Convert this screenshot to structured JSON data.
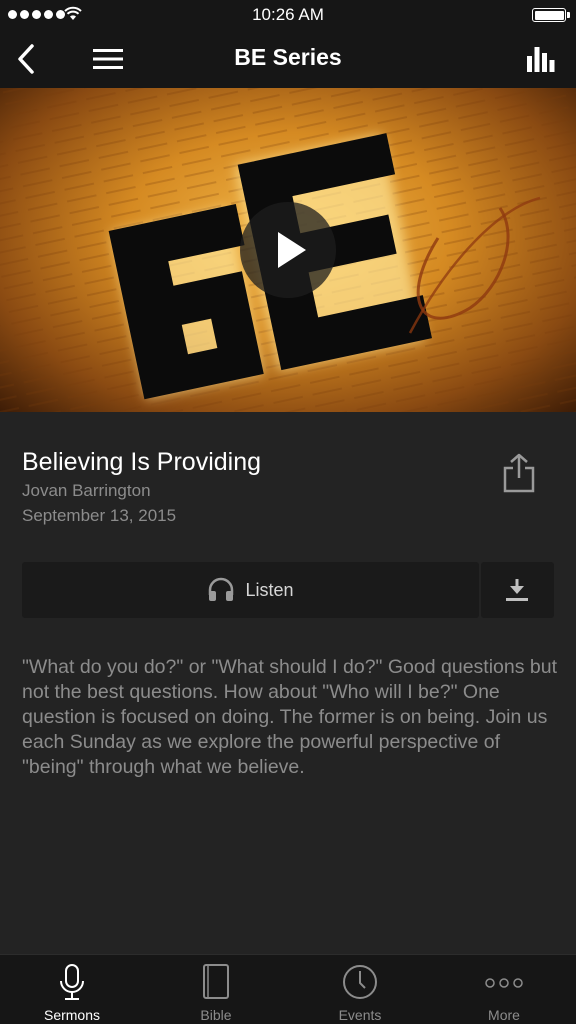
{
  "status_bar": {
    "time": "10:26 AM",
    "signal_icon": "signal-dots-icon",
    "wifi_icon": "wifi-icon",
    "battery_icon": "battery-icon",
    "battery_level": 1.0
  },
  "nav_bar": {
    "title": "BE Series",
    "back_icon": "chevron-left-icon",
    "menu_icon": "hamburger-menu-icon",
    "stats_icon": "bar-chart-icon"
  },
  "hero": {
    "art_text": "BE",
    "play_icon": "play-icon"
  },
  "sermon": {
    "title": "Believing Is Providing",
    "speaker": "Jovan Barrington",
    "date": "September 13, 2015",
    "share_icon": "share-icon"
  },
  "actions": {
    "listen_label": "Listen",
    "listen_icon": "headphones-icon",
    "download_icon": "download-icon"
  },
  "description": "\"What do you do?\" or \"What should I do?\" Good questions but not the best questions. How about \"Who will I be?\" One question is focused on doing. The former is on being. Join us each Sunday as we explore the powerful perspective of \"being\" through what we believe.",
  "tab_bar": {
    "tabs": [
      {
        "label": "Sermons",
        "icon": "microphone-icon",
        "active": true
      },
      {
        "label": "Bible",
        "icon": "book-icon",
        "active": false
      },
      {
        "label": "Events",
        "icon": "clock-icon",
        "active": false
      },
      {
        "label": "More",
        "icon": "more-dots-icon",
        "active": false
      }
    ]
  },
  "colors": {
    "background": "#232323",
    "bar_background": "#161616",
    "secondary_text": "#8c8c8c",
    "hero_orange": "#d58a22"
  }
}
